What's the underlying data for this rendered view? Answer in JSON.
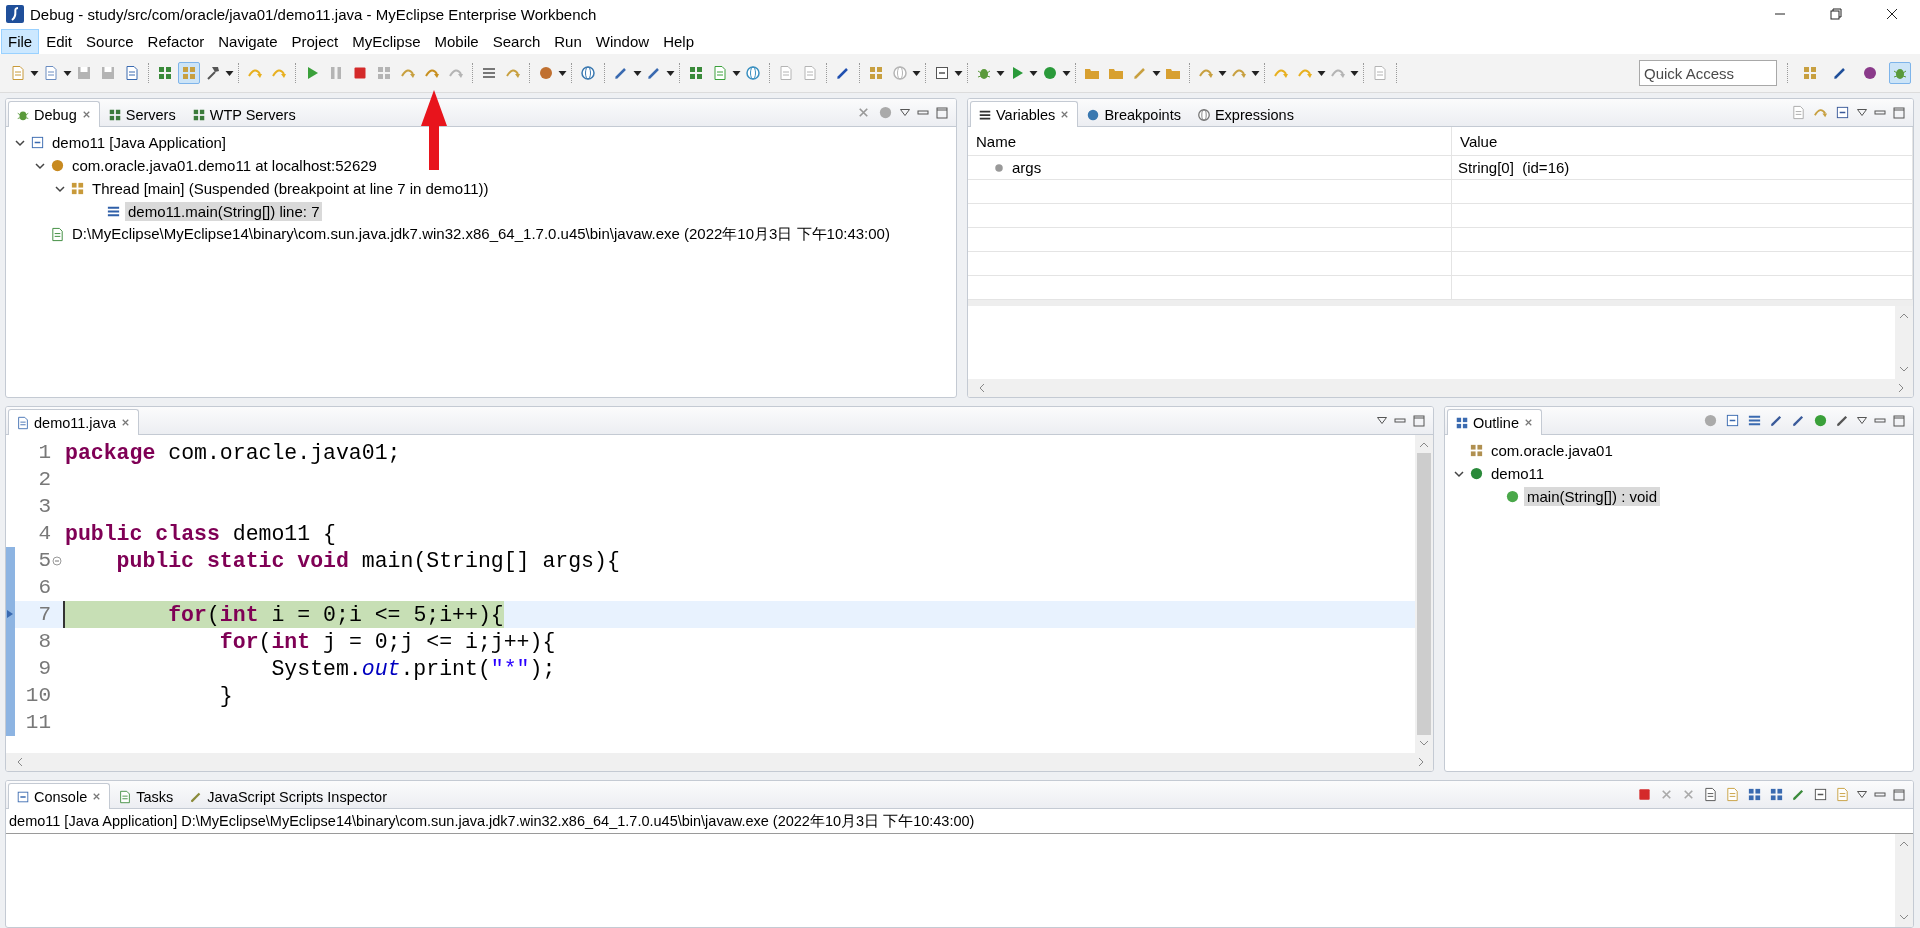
{
  "window": {
    "title": "Debug - study/src/com/oracle/java01/demo11.java - MyEclipse Enterprise Workbench"
  },
  "menu": [
    {
      "label": "File",
      "selected": true
    },
    {
      "label": "Edit",
      "selected": false
    },
    {
      "label": "Source",
      "selected": false
    },
    {
      "label": "Refactor",
      "selected": false
    },
    {
      "label": "Navigate",
      "selected": false
    },
    {
      "label": "Project",
      "selected": false
    },
    {
      "label": "MyEclipse",
      "selected": false
    },
    {
      "label": "Mobile",
      "selected": false
    },
    {
      "label": "Search",
      "selected": false
    },
    {
      "label": "Run",
      "selected": false
    },
    {
      "label": "Window",
      "selected": false
    },
    {
      "label": "Help",
      "selected": false
    }
  ],
  "toolbar": {
    "groups": [
      [
        {
          "dropdown": true,
          "disabled": false,
          "on": false
        },
        {
          "dropdown": true,
          "disabled": false,
          "on": false
        },
        {
          "dropdown": false,
          "disabled": true,
          "on": false
        },
        {
          "dropdown": false,
          "disabled": true,
          "on": false
        },
        {
          "dropdown": false,
          "disabled": false,
          "on": false
        }
      ],
      [
        {
          "dropdown": false,
          "disabled": false,
          "on": false
        },
        {
          "dropdown": false,
          "disabled": false,
          "on": true
        },
        {
          "dropdown": true,
          "disabled": false,
          "on": false
        }
      ],
      [
        {
          "dropdown": false,
          "disabled": false,
          "on": false
        },
        {
          "dropdown": false,
          "disabled": false,
          "on": false
        }
      ],
      [
        {
          "dropdown": false,
          "disabled": false,
          "on": false
        },
        {
          "dropdown": false,
          "disabled": true,
          "on": false
        },
        {
          "dropdown": false,
          "disabled": false,
          "on": false
        },
        {
          "dropdown": false,
          "disabled": true,
          "on": false
        },
        {
          "dropdown": false,
          "disabled": false,
          "on": false
        },
        {
          "dropdown": false,
          "disabled": false,
          "on": false
        },
        {
          "dropdown": false,
          "disabled": true,
          "on": false
        }
      ],
      [
        {
          "dropdown": false,
          "disabled": false,
          "on": false
        },
        {
          "dropdown": false,
          "disabled": false,
          "on": false
        }
      ],
      [
        {
          "dropdown": true,
          "disabled": false,
          "on": false
        }
      ],
      [
        {
          "dropdown": false,
          "disabled": false,
          "on": false
        }
      ],
      [
        {
          "dropdown": true,
          "disabled": false,
          "on": false
        },
        {
          "dropdown": true,
          "disabled": false,
          "on": false
        }
      ],
      [
        {
          "dropdown": false,
          "disabled": false,
          "on": false
        },
        {
          "dropdown": true,
          "disabled": false,
          "on": false
        },
        {
          "dropdown": false,
          "disabled": false,
          "on": false
        }
      ],
      [
        {
          "dropdown": false,
          "disabled": true,
          "on": false
        },
        {
          "dropdown": false,
          "disabled": true,
          "on": false
        }
      ],
      [
        {
          "dropdown": false,
          "disabled": false,
          "on": false
        }
      ],
      [
        {
          "dropdown": false,
          "disabled": false,
          "on": false
        },
        {
          "dropdown": true,
          "disabled": true,
          "on": false
        }
      ],
      [
        {
          "dropdown": true,
          "disabled": false,
          "on": false
        }
      ],
      [
        {
          "dropdown": true,
          "disabled": false,
          "on": false
        },
        {
          "dropdown": true,
          "disabled": false,
          "on": false
        },
        {
          "dropdown": true,
          "disabled": false,
          "on": false
        }
      ],
      [
        {
          "dropdown": false,
          "disabled": false,
          "on": false
        },
        {
          "dropdown": false,
          "disabled": false,
          "on": false
        },
        {
          "dropdown": true,
          "disabled": false,
          "on": false
        },
        {
          "dropdown": false,
          "disabled": false,
          "on": false
        }
      ],
      [
        {
          "dropdown": true,
          "disabled": false,
          "on": false
        },
        {
          "dropdown": true,
          "disabled": false,
          "on": false
        }
      ],
      [
        {
          "dropdown": false,
          "disabled": false,
          "on": false
        },
        {
          "dropdown": true,
          "disabled": false,
          "on": false
        },
        {
          "dropdown": true,
          "disabled": true,
          "on": false
        }
      ],
      [
        {
          "dropdown": false,
          "disabled": true,
          "on": false
        }
      ]
    ]
  },
  "quick_access": {
    "placeholder": "Quick Access"
  },
  "perspectives": [
    {
      "on": false
    },
    {
      "on": false
    },
    {
      "on": false
    },
    {
      "on": true
    }
  ],
  "debug_view": {
    "tabs": [
      {
        "label": "Debug",
        "selected": true
      },
      {
        "label": "Servers",
        "selected": false
      },
      {
        "label": "WTP Servers",
        "selected": false
      }
    ],
    "tree": [
      {
        "kind": "launch",
        "label": "demo11 [Java Application]",
        "expanded": true,
        "selected": false,
        "children": [
          {
            "kind": "target",
            "label": "com.oracle.java01.demo11 at localhost:52629",
            "expanded": true,
            "selected": false,
            "children": [
              {
                "kind": "thread",
                "label": "Thread [main] (Suspended (breakpoint at line 7 in demo11))",
                "expanded": true,
                "selected": false,
                "children": [
                  {
                    "kind": "frame",
                    "label": "demo11.main(String[]) line: 7",
                    "selected": true
                  }
                ]
              }
            ]
          },
          {
            "kind": "process",
            "label": "D:\\MyEclipse\\MyEclipse14\\binary\\com.sun.java.jdk7.win32.x86_64_1.7.0.u45\\bin\\javaw.exe (2022年10月3日 下午10:43:00)",
            "selected": false
          }
        ]
      }
    ]
  },
  "variables_view": {
    "tabs": [
      {
        "label": "Variables",
        "selected": true
      },
      {
        "label": "Breakpoints",
        "selected": false
      },
      {
        "label": "Expressions",
        "selected": false
      }
    ],
    "columns": [
      "Name",
      "Value"
    ],
    "rows": [
      {
        "name": "args",
        "value": "String[0]  (id=16)"
      }
    ]
  },
  "editor": {
    "tabs": [
      {
        "label": "demo11.java",
        "selected": true
      }
    ],
    "lines": [
      {
        "number": "1",
        "current": false,
        "range": false,
        "fold": false,
        "tokens": [
          {
            "kind": "kw",
            "text": "package"
          },
          {
            "kind": "plain",
            "text": " com.oracle.java01;"
          }
        ]
      },
      {
        "number": "2",
        "current": false,
        "range": false,
        "fold": false
      },
      {
        "number": "3",
        "current": false,
        "range": false,
        "fold": false
      },
      {
        "number": "4",
        "current": false,
        "range": false,
        "fold": false,
        "tokens": [
          {
            "kind": "kw",
            "text": "public"
          },
          {
            "kind": "kw",
            "text": " class"
          },
          {
            "kind": "plain",
            "text": " demo11 {"
          }
        ]
      },
      {
        "number": "5",
        "current": false,
        "range": true,
        "fold": true,
        "tokens": [
          {
            "kind": "kw",
            "text": "    public"
          },
          {
            "kind": "kw",
            "text": " static"
          },
          {
            "kind": "kw",
            "text": " void"
          },
          {
            "kind": "plain",
            "text": " main(String[] args){"
          }
        ]
      },
      {
        "number": "6",
        "current": false,
        "range": true,
        "fold": false
      },
      {
        "number": "7",
        "current": true,
        "range": true,
        "fold": false,
        "tokens": [
          {
            "kind": "kw",
            "text": "        for"
          },
          {
            "kind": "plain",
            "text": "("
          },
          {
            "kind": "kw",
            "text": "int"
          },
          {
            "kind": "plain",
            "text": " i = 0;i <= 5;i++){"
          }
        ]
      },
      {
        "number": "8",
        "current": false,
        "range": true,
        "fold": false,
        "tokens": [
          {
            "kind": "kw",
            "text": "            for"
          },
          {
            "kind": "plain",
            "text": "("
          },
          {
            "kind": "kw",
            "text": "int"
          },
          {
            "kind": "plain",
            "text": " j = 0;j <= i;j++){"
          }
        ]
      },
      {
        "number": "9",
        "current": false,
        "range": true,
        "fold": false,
        "tokens": [
          {
            "kind": "plain",
            "text": "                System."
          },
          {
            "kind": "field",
            "text": "out"
          },
          {
            "kind": "plain",
            "text": ".print("
          },
          {
            "kind": "str",
            "text": "\"*\""
          },
          {
            "kind": "plain",
            "text": ");"
          }
        ]
      },
      {
        "number": "10",
        "current": false,
        "range": true,
        "fold": false,
        "tokens": [
          {
            "kind": "plain",
            "text": "            }"
          }
        ]
      },
      {
        "number": "11",
        "current": false,
        "range": true,
        "fold": false
      }
    ]
  },
  "outline_view": {
    "tabs": [
      {
        "label": "Outline",
        "selected": true
      }
    ],
    "tree": [
      {
        "kind": "package",
        "label": "com.oracle.java01",
        "selected": false
      },
      {
        "kind": "class",
        "label": "demo11",
        "expanded": true,
        "selected": false,
        "children": [
          {
            "kind": "method",
            "label": "main(String[]) : void",
            "selected": true
          }
        ]
      }
    ]
  },
  "console_view": {
    "tabs": [
      {
        "label": "Console",
        "selected": true
      },
      {
        "label": "Tasks",
        "selected": false
      },
      {
        "label": "JavaScript Scripts Inspector",
        "selected": false
      }
    ],
    "header": "demo11 [Java Application] D:\\MyEclipse\\MyEclipse14\\binary\\com.sun.java.jdk7.win32.x86_64_1.7.0.u45\\bin\\javaw.exe (2022年10月3日 下午10:43:00)"
  }
}
